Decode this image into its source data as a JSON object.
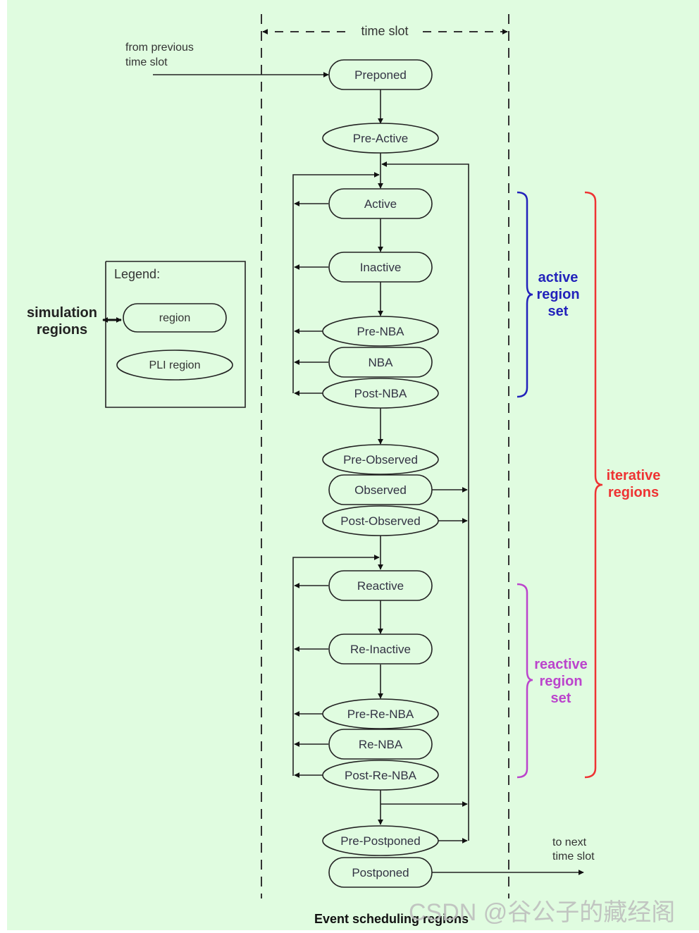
{
  "title": "Event scheduling regions",
  "watermark": "CSDN @谷公子的藏经阁",
  "time_slot_label": "time slot",
  "from_previous": [
    "from previous",
    "time slot"
  ],
  "to_next": [
    "to next",
    "time slot"
  ],
  "legend": {
    "title": "Legend:",
    "region_label": "region",
    "pli_region_label": "PLI region",
    "pointer_label": [
      "simulation",
      "regions"
    ]
  },
  "regions": [
    {
      "id": "preponed",
      "label": "Preponed",
      "kind": "region"
    },
    {
      "id": "pre-active",
      "label": "Pre-Active",
      "kind": "pli"
    },
    {
      "id": "active",
      "label": "Active",
      "kind": "region"
    },
    {
      "id": "inactive",
      "label": "Inactive",
      "kind": "region"
    },
    {
      "id": "pre-nba",
      "label": "Pre-NBA",
      "kind": "pli"
    },
    {
      "id": "nba",
      "label": "NBA",
      "kind": "region"
    },
    {
      "id": "post-nba",
      "label": "Post-NBA",
      "kind": "pli"
    },
    {
      "id": "pre-observed",
      "label": "Pre-Observed",
      "kind": "pli"
    },
    {
      "id": "observed",
      "label": "Observed",
      "kind": "region"
    },
    {
      "id": "post-observed",
      "label": "Post-Observed",
      "kind": "pli"
    },
    {
      "id": "reactive",
      "label": "Reactive",
      "kind": "region"
    },
    {
      "id": "re-inactive",
      "label": "Re-Inactive",
      "kind": "region"
    },
    {
      "id": "pre-re-nba",
      "label": "Pre-Re-NBA",
      "kind": "pli"
    },
    {
      "id": "re-nba",
      "label": "Re-NBA",
      "kind": "region"
    },
    {
      "id": "post-re-nba",
      "label": "Post-Re-NBA",
      "kind": "pli"
    },
    {
      "id": "pre-postponed",
      "label": "Pre-Postponed",
      "kind": "pli"
    },
    {
      "id": "postponed",
      "label": "Postponed",
      "kind": "region"
    }
  ],
  "braces": {
    "active_set": {
      "label": [
        "active",
        "region",
        "set"
      ],
      "color": "#2222bb"
    },
    "reactive_set": {
      "label": [
        "reactive",
        "region",
        "set"
      ],
      "color": "#bb44cc"
    },
    "iterative": {
      "label": [
        "iterative",
        "regions"
      ],
      "color": "#ee3333"
    }
  },
  "colors": {
    "background": "#e0fce0",
    "stroke": "#222222",
    "text": "#333344"
  }
}
